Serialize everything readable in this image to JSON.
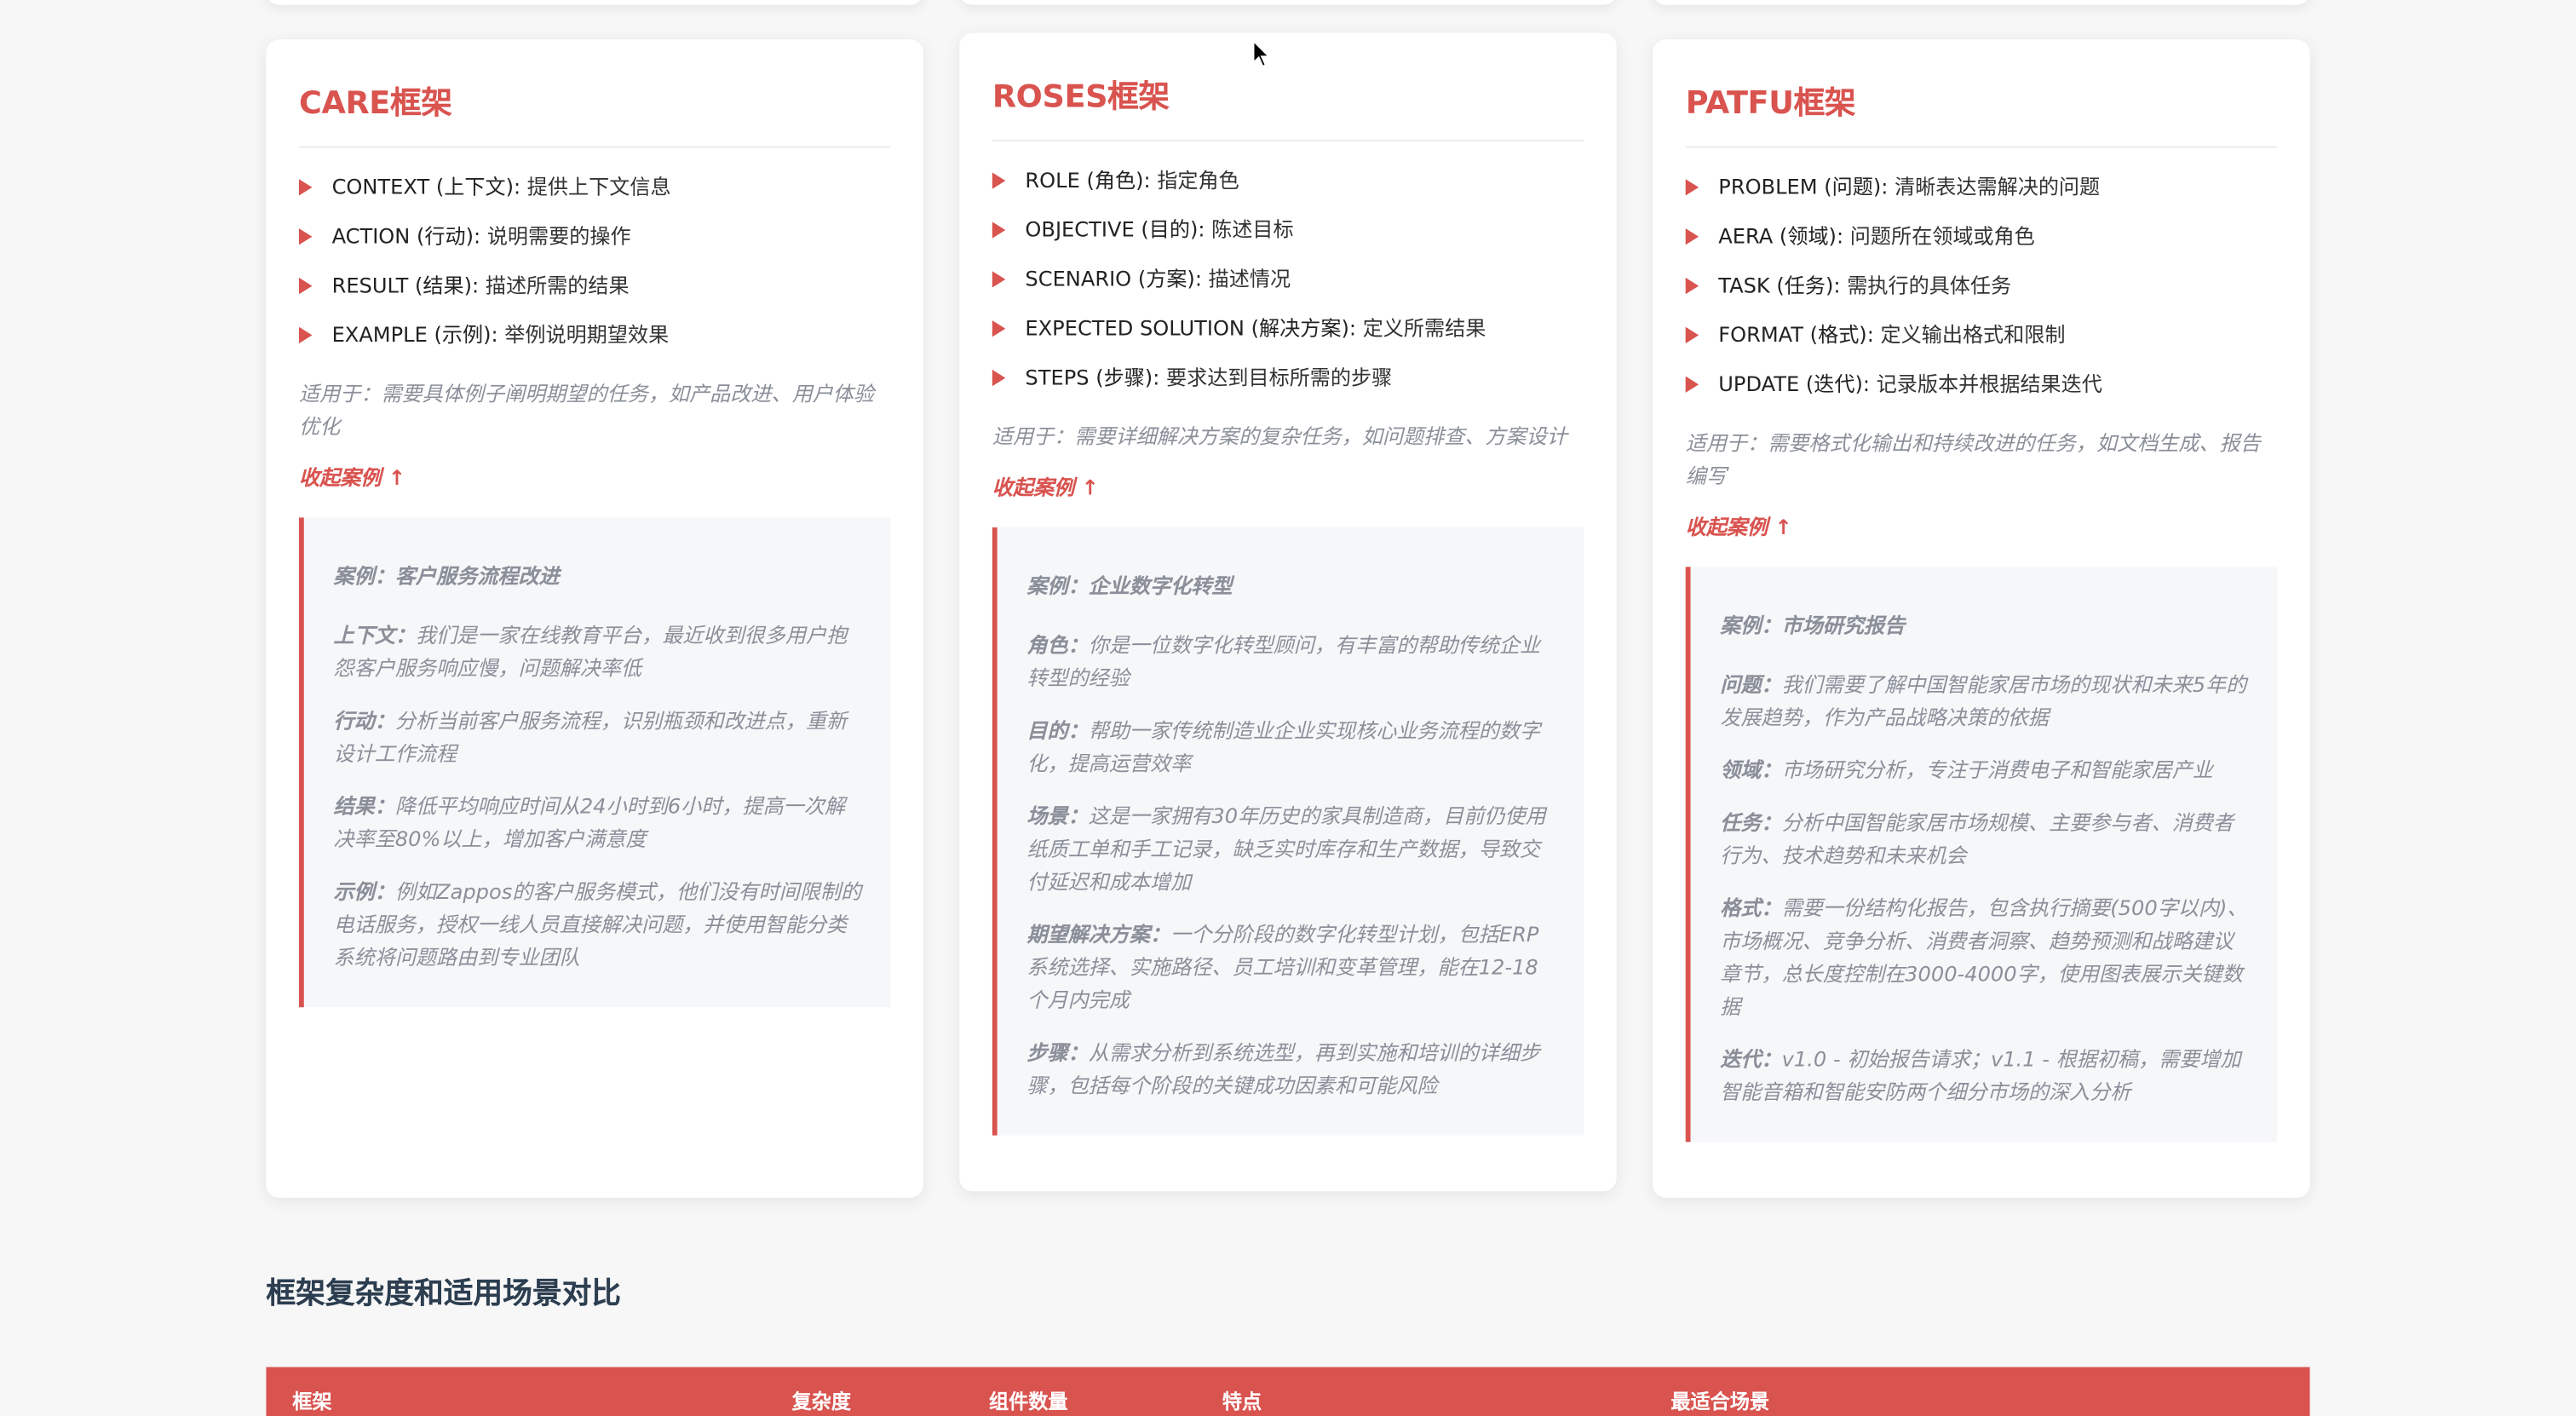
{
  "cards": [
    {
      "title": "CARE框架",
      "items": [
        {
          "key": "CONTEXT (上下文):",
          "value": "提供上下文信息"
        },
        {
          "key": "ACTION (行动):",
          "value": "说明需要的操作"
        },
        {
          "key": "RESULT (结果):",
          "value": "描述所需的结果"
        },
        {
          "key": "EXAMPLE (示例):",
          "value": "举例说明期望效果"
        }
      ],
      "applies": "适用于：需要具体例子阐明期望的任务，如产品改进、用户体验优化",
      "collapse": "收起案例 ↑",
      "example": {
        "case": "案例：客户服务流程改进",
        "lines": [
          {
            "label": "上下文：",
            "text": "我们是一家在线教育平台，最近收到很多用户抱怨客户服务响应慢，问题解决率低"
          },
          {
            "label": "行动：",
            "text": "分析当前客户服务流程，识别瓶颈和改进点，重新设计工作流程"
          },
          {
            "label": "结果：",
            "text": "降低平均响应时间从24小时到6小时，提高一次解决率至80%以上，增加客户满意度"
          },
          {
            "label": "示例：",
            "text": "例如Zappos的客户服务模式，他们没有时间限制的电话服务，授权一线人员直接解决问题，并使用智能分类系统将问题路由到专业团队"
          }
        ]
      }
    },
    {
      "title": "ROSES框架",
      "items": [
        {
          "key": "ROLE (角色):",
          "value": "指定角色"
        },
        {
          "key": "OBJECTIVE (目的):",
          "value": "陈述目标"
        },
        {
          "key": "SCENARIO (方案):",
          "value": "描述情况"
        },
        {
          "key": "EXPECTED SOLUTION (解决方案):",
          "value": "定义所需结果"
        },
        {
          "key": "STEPS (步骤):",
          "value": "要求达到目标所需的步骤"
        }
      ],
      "applies": "适用于：需要详细解决方案的复杂任务，如问题排查、方案设计",
      "collapse": "收起案例 ↑",
      "example": {
        "case": "案例：企业数字化转型",
        "lines": [
          {
            "label": "角色：",
            "text": "你是一位数字化转型顾问，有丰富的帮助传统企业转型的经验"
          },
          {
            "label": "目的：",
            "text": "帮助一家传统制造业企业实现核心业务流程的数字化，提高运营效率"
          },
          {
            "label": "场景：",
            "text": "这是一家拥有30年历史的家具制造商，目前仍使用纸质工单和手工记录，缺乏实时库存和生产数据，导致交付延迟和成本增加"
          },
          {
            "label": "期望解决方案：",
            "text": "一个分阶段的数字化转型计划，包括ERP系统选择、实施路径、员工培训和变革管理，能在12-18个月内完成"
          },
          {
            "label": "步骤：",
            "text": "从需求分析到系统选型，再到实施和培训的详细步骤，包括每个阶段的关键成功因素和可能风险"
          }
        ]
      }
    },
    {
      "title": "PATFU框架",
      "items": [
        {
          "key": "PROBLEM (问题):",
          "value": "清晰表达需解决的问题"
        },
        {
          "key": "AERA (领域):",
          "value": "问题所在领域或角色"
        },
        {
          "key": "TASK (任务):",
          "value": "需执行的具体任务"
        },
        {
          "key": "FORMAT (格式):",
          "value": "定义输出格式和限制"
        },
        {
          "key": "UPDATE (迭代):",
          "value": "记录版本并根据结果迭代"
        }
      ],
      "applies": "适用于：需要格式化输出和持续改进的任务，如文档生成、报告编写",
      "collapse": "收起案例 ↑",
      "example": {
        "case": "案例：市场研究报告",
        "lines": [
          {
            "label": "问题：",
            "text": "我们需要了解中国智能家居市场的现状和未来5年的发展趋势，作为产品战略决策的依据"
          },
          {
            "label": "领域：",
            "text": "市场研究分析，专注于消费电子和智能家居产业"
          },
          {
            "label": "任务：",
            "text": "分析中国智能家居市场规模、主要参与者、消费者行为、技术趋势和未来机会"
          },
          {
            "label": "格式：",
            "text": "需要一份结构化报告，包含执行摘要(500字以内)、市场概况、竞争分析、消费者洞察、趋势预测和战略建议章节，总长度控制在3000-4000字，使用图表展示关键数据"
          },
          {
            "label": "迭代：",
            "text": "v1.0 - 初始报告请求；v1.1 - 根据初稿，需要增加智能音箱和智能安防两个细分市场的深入分析"
          }
        ]
      }
    }
  ],
  "section_title": "框架复杂度和适用场景对比",
  "table_headers": [
    "框架",
    "复杂度",
    "组件数量",
    "特点",
    "最适合场景"
  ]
}
